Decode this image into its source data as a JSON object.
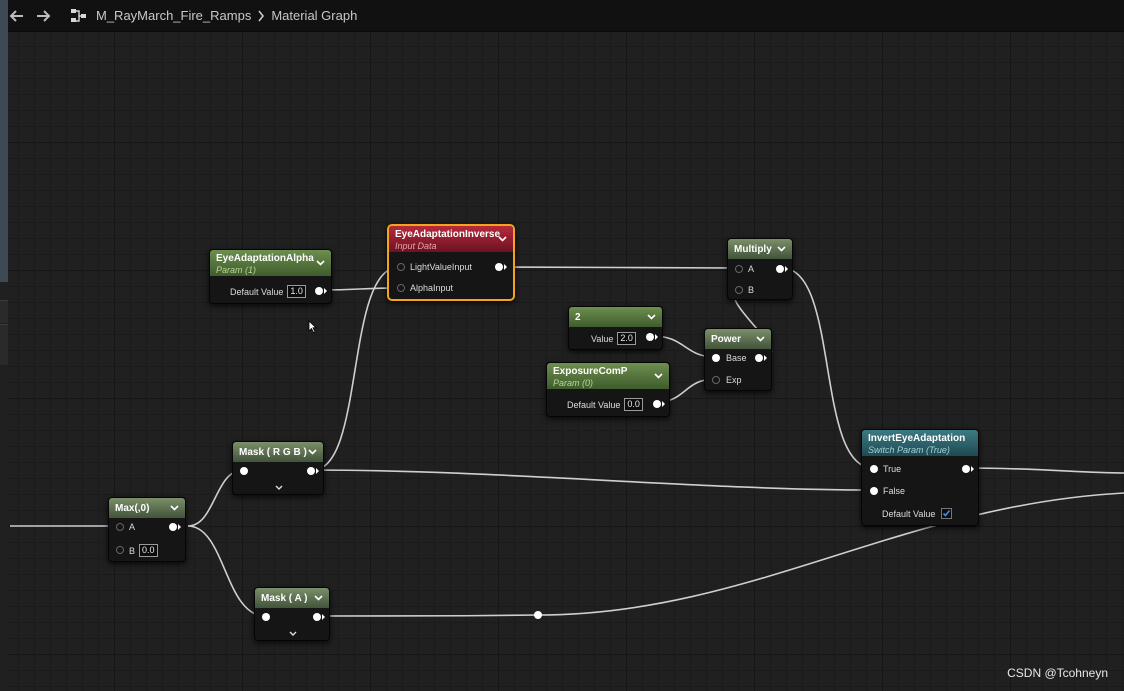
{
  "topbar": {
    "back_label": "",
    "asset_name": "M_RayMarch_Fire_Ramps",
    "current_view": "Material Graph"
  },
  "nodes": {
    "eye_alpha": {
      "title": "EyeAdaptationAlpha",
      "subtitle": "Param (1)",
      "default_label": "Default Value",
      "default_value": "1.0"
    },
    "eye_inverse": {
      "title": "EyeAdaptationInverse",
      "subtitle": "Input Data",
      "pin1": "LightValueInput",
      "pin2": "AlphaInput"
    },
    "multiply": {
      "title": "Multiply",
      "pin_a": "A",
      "pin_b": "B"
    },
    "const2": {
      "title": "2",
      "value_label": "Value",
      "value": "2.0"
    },
    "power": {
      "title": "Power",
      "pin_base": "Base",
      "pin_exp": "Exp"
    },
    "exposure": {
      "title": "ExposureComP",
      "subtitle": "Param (0)",
      "default_label": "Default Value",
      "default_value": "0.0"
    },
    "invert": {
      "title": "InvertEyeAdaptation",
      "subtitle": "Switch Param (True)",
      "pin_true": "True",
      "pin_false": "False",
      "default_label": "Default Value",
      "default_checked": true
    },
    "mask_rgb": {
      "title": "Mask ( R G B )"
    },
    "max": {
      "title": "Max(,0)",
      "pin_a": "A",
      "pin_b": "B",
      "b_value": "0.0"
    },
    "mask_a": {
      "title": "Mask ( A )"
    }
  },
  "watermark": "CSDN @Tcohneyn",
  "colors": {
    "selection_outline": "#f3a41c",
    "param_header": "#6d8f4f",
    "input_data_header": "#b52a3d",
    "switch_param_header": "#3c7a82",
    "wire": "#d0d0d0"
  }
}
